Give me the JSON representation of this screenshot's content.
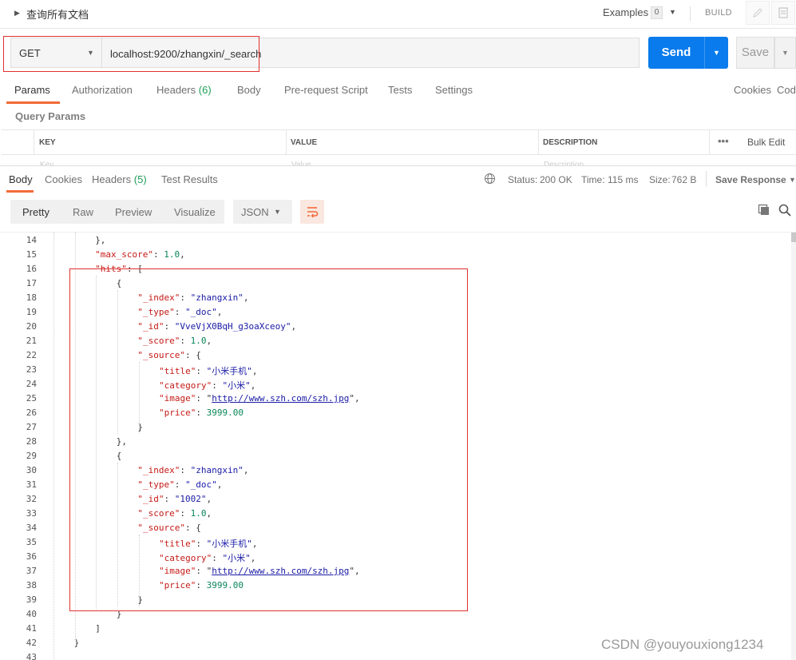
{
  "topbar": {
    "title": "查询所有文档",
    "examples_label": "Examples",
    "examples_count": "0",
    "build_label": "BUILD"
  },
  "request": {
    "method": "GET",
    "url": "localhost:9200/zhangxin/_search",
    "send_label": "Send",
    "save_label": "Save"
  },
  "request_tabs": {
    "params": "Params",
    "authorization": "Authorization",
    "headers": "Headers",
    "headers_count": "(6)",
    "body": "Body",
    "prerequest": "Pre-request Script",
    "tests": "Tests",
    "settings": "Settings",
    "cookies": "Cookies",
    "code": "Code"
  },
  "query_params": {
    "title": "Query Params",
    "columns": [
      "KEY",
      "VALUE",
      "DESCRIPTION"
    ],
    "more": "•••",
    "bulk_edit": "Bulk Edit",
    "placeholders": [
      "Key",
      "Value",
      "Description"
    ]
  },
  "response": {
    "tabs": {
      "body": "Body",
      "cookies": "Cookies",
      "headers": "Headers",
      "headers_count": "(5)",
      "test_results": "Test Results"
    },
    "status_label": "Status:",
    "status_value": "200 OK",
    "time_label": "Time:",
    "time_value": "115 ms",
    "size_label": "Size:",
    "size_value": "762 B",
    "save_response": "Save Response"
  },
  "format": {
    "views": [
      "Pretty",
      "Raw",
      "Preview",
      "Visualize"
    ],
    "active_view": "Pretty",
    "language": "JSON"
  },
  "code_lines": [
    {
      "n": "14",
      "t": "},"
    },
    {
      "n": "15",
      "t": "\"max_score\": 1.0,"
    },
    {
      "n": "16",
      "t": "\"hits\": ["
    },
    {
      "n": "17",
      "t": "{"
    },
    {
      "n": "18",
      "t": "\"_index\": \"zhangxin\","
    },
    {
      "n": "19",
      "t": "\"_type\": \"_doc\","
    },
    {
      "n": "20",
      "t": "\"_id\": \"VveVjX0BqH_g3oaXceoy\","
    },
    {
      "n": "21",
      "t": "\"_score\": 1.0,"
    },
    {
      "n": "22",
      "t": "\"_source\": {"
    },
    {
      "n": "23",
      "t": "\"title\": \"小米手机\","
    },
    {
      "n": "24",
      "t": "\"category\": \"小米\","
    },
    {
      "n": "25",
      "t": "\"image\": \"http://www.szh.com/szh.jpg\","
    },
    {
      "n": "26",
      "t": "\"price\": 3999.00"
    },
    {
      "n": "27",
      "t": "}"
    },
    {
      "n": "28",
      "t": "},"
    },
    {
      "n": "29",
      "t": "{"
    },
    {
      "n": "30",
      "t": "\"_index\": \"zhangxin\","
    },
    {
      "n": "31",
      "t": "\"_type\": \"_doc\","
    },
    {
      "n": "32",
      "t": "\"_id\": \"1002\","
    },
    {
      "n": "33",
      "t": "\"_score\": 1.0,"
    },
    {
      "n": "34",
      "t": "\"_source\": {"
    },
    {
      "n": "35",
      "t": "\"title\": \"小米手机\","
    },
    {
      "n": "36",
      "t": "\"category\": \"小米\","
    },
    {
      "n": "37",
      "t": "\"image\": \"http://www.szh.com/szh.jpg\","
    },
    {
      "n": "38",
      "t": "\"price\": 3999.00"
    },
    {
      "n": "39",
      "t": "}"
    },
    {
      "n": "40",
      "t": "}"
    },
    {
      "n": "41",
      "t": "]"
    },
    {
      "n": "42",
      "t": "}"
    },
    {
      "n": "43",
      "t": ""
    }
  ],
  "watermark": "CSDN @youyouxiong1234",
  "colors": {
    "accent": "#f26b3a",
    "send": "#097bed",
    "status_ok": "#1f9e57"
  }
}
